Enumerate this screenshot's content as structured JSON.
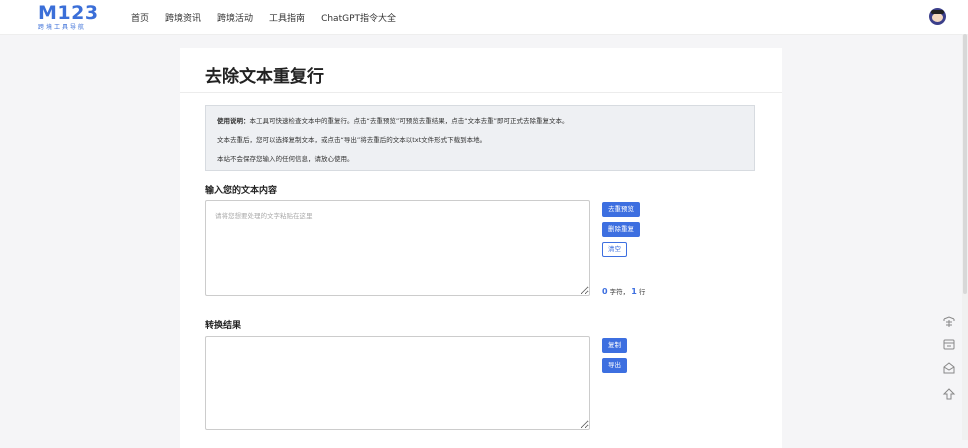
{
  "logo": {
    "main": "M123",
    "sub": "跨境工具导航"
  },
  "nav": [
    {
      "label": "首页"
    },
    {
      "label": "跨境资讯"
    },
    {
      "label": "跨境活动"
    },
    {
      "label": "工具指南"
    },
    {
      "label": "ChatGPT指令大全"
    }
  ],
  "page": {
    "title": "去除文本重复行"
  },
  "note": {
    "line1_bold": "使用说明：",
    "line1": "本工具可快速检查文本中的重复行。点击“去重预览”可预览去重结果，点击“文本去重”即可正式去除重复文本。",
    "line2": "文本去重后，您可以选择复制文本，或点击“导出”将去重后的文本以txt文件形式下载到本地。",
    "line3": "本站不会保存您输入的任何信息，请放心使用。"
  },
  "input_section": {
    "heading": "输入您的文本内容",
    "placeholder": "请将您想要处理的文字粘贴在这里",
    "value": "",
    "buttons": {
      "preview": "去重预览",
      "dedupe": "删除重复",
      "clear": "清空"
    },
    "stats": {
      "chars": "0",
      "chars_unit": "字符，",
      "lines": "1",
      "lines_unit": "行"
    }
  },
  "output_section": {
    "heading": "转换结果",
    "value": "",
    "buttons": {
      "copy": "复制",
      "export": "导出"
    }
  },
  "side_tools": [
    "message-icon",
    "shop-icon",
    "mail-icon",
    "back-to-top-icon"
  ],
  "colors": {
    "accent": "#3d6fe0",
    "note_bg": "#eef0f3"
  }
}
